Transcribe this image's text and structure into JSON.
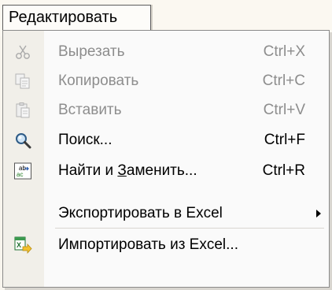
{
  "menubar": {
    "item_label": "Редактировать"
  },
  "menu": {
    "items": [
      {
        "label": "Вырезать",
        "shortcut": "Ctrl+X",
        "icon": "scissors-icon",
        "enabled": false
      },
      {
        "label": "Копировать",
        "shortcut": "Ctrl+C",
        "icon": "copy-icon",
        "enabled": false
      },
      {
        "label": "Вставить",
        "shortcut": "Ctrl+V",
        "icon": "paste-icon",
        "enabled": false
      },
      {
        "label": "Поиск...",
        "shortcut": "Ctrl+F",
        "icon": "magnifier-icon",
        "enabled": true
      },
      {
        "label_pre": "Найти и ",
        "label_ul": "З",
        "label_post": "аменить...",
        "shortcut": "Ctrl+R",
        "icon": "find-replace-icon",
        "enabled": true
      },
      {
        "label": "Экспортировать в Excel",
        "icon": "submenu-arrow-icon",
        "enabled": true
      },
      {
        "label": "Импортировать из Excel...",
        "icon": "excel-import-icon",
        "enabled": true
      }
    ]
  },
  "colors": {
    "disabled_text": "#8d8d8d",
    "enabled_text": "#000000",
    "menu_background": "#fafafa"
  }
}
